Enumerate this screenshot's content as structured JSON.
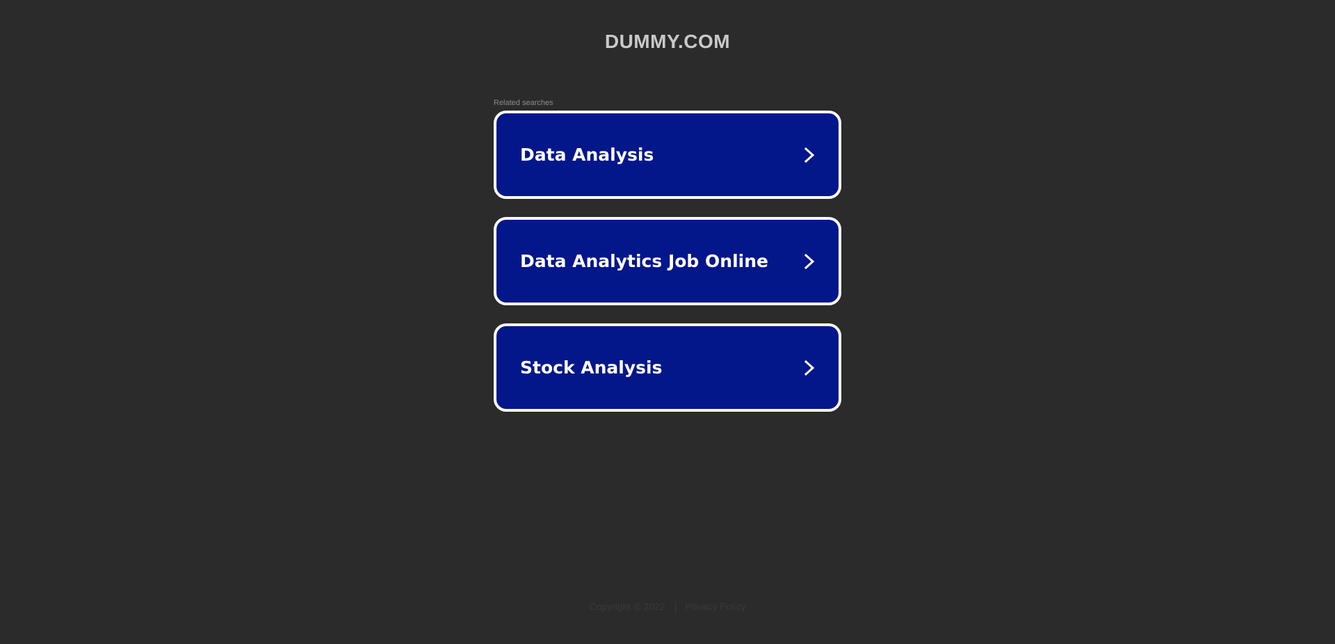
{
  "header": {
    "site_title": "DUMMY.COM"
  },
  "related": {
    "label": "Related searches",
    "items": [
      {
        "label": "Data Analysis",
        "icon": "chevron-right-icon"
      },
      {
        "label": "Data Analytics Job Online",
        "icon": "chevron-right-icon"
      },
      {
        "label": "Stock Analysis",
        "icon": "chevron-right-icon"
      }
    ]
  },
  "footer": {
    "copyright": "Copyright © 2022",
    "privacy_link": "Privacy Policy"
  },
  "colors": {
    "background": "#2b2b2b",
    "button_fill": "#03178a",
    "button_border": "#ffffff",
    "title_text": "#c9c9c9"
  }
}
